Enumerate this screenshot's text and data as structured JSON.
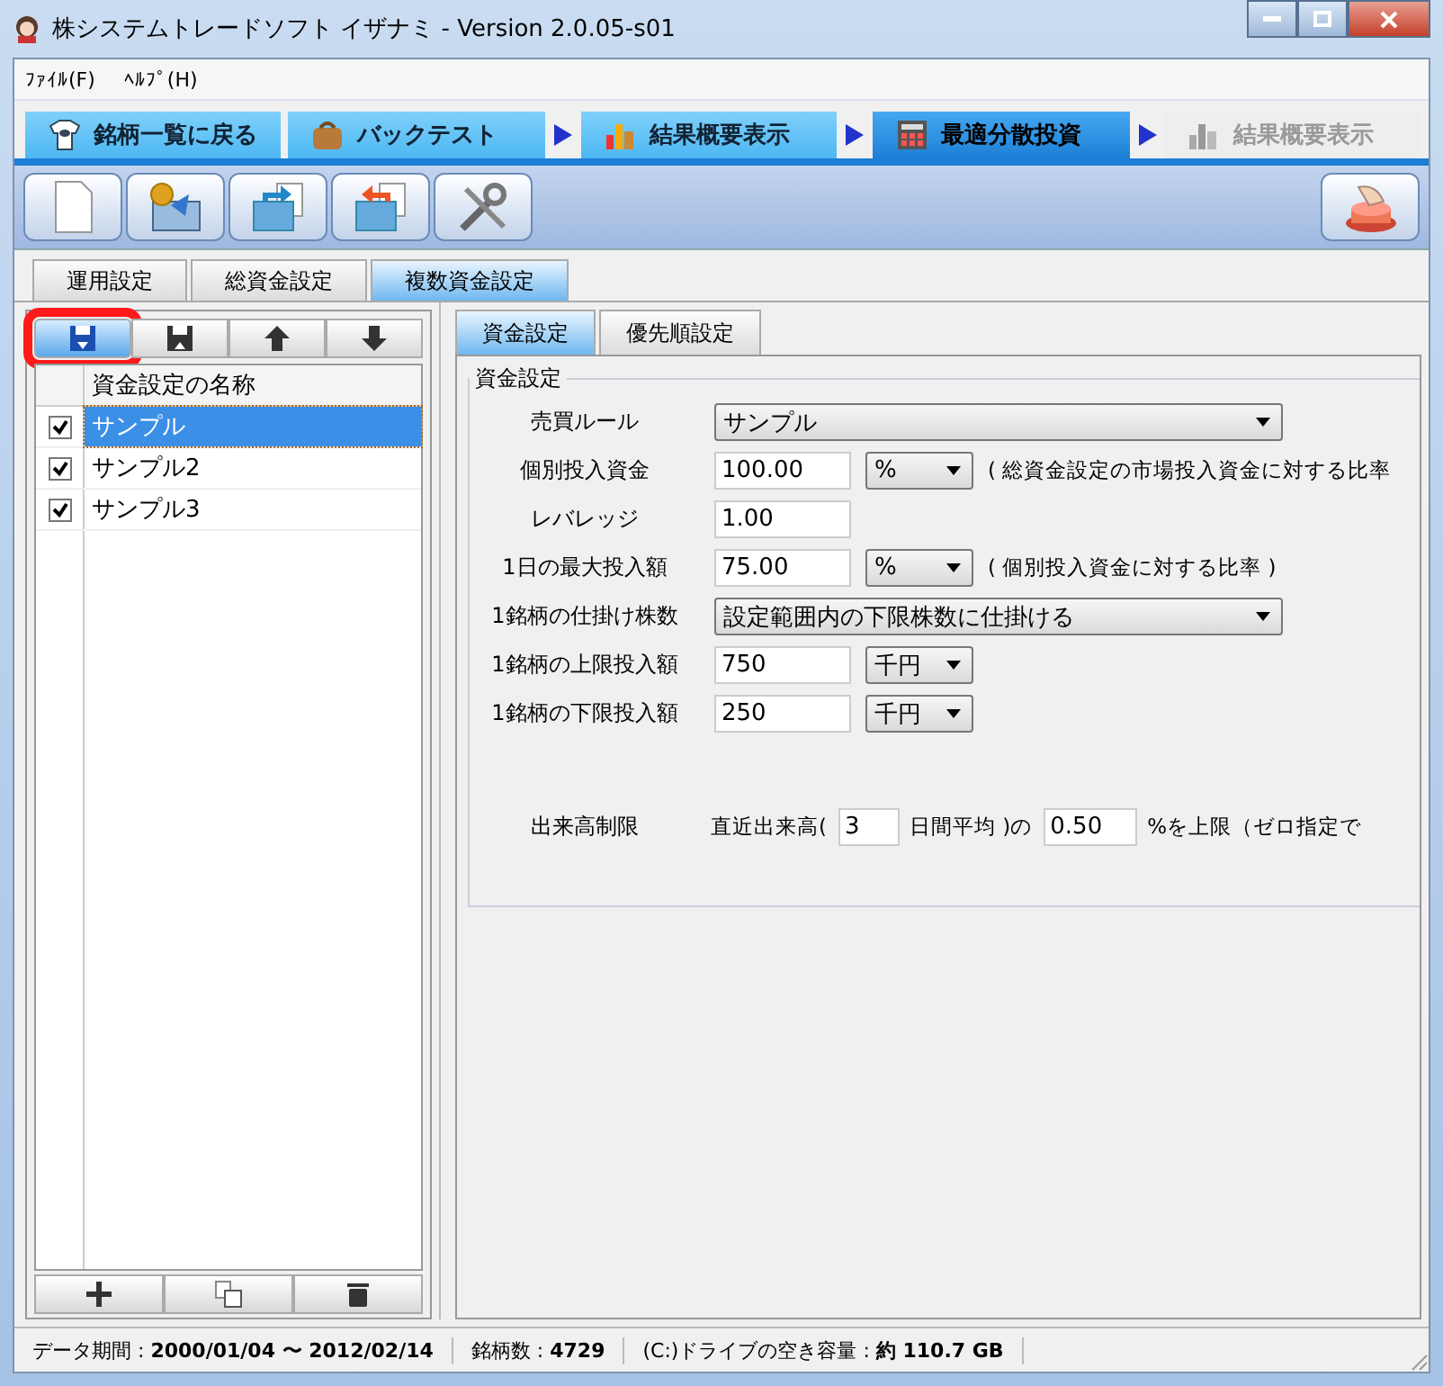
{
  "window": {
    "title": "株システムトレードソフト イザナミ - Version 2.0.05-s01"
  },
  "menu": [
    {
      "label": "ﾌｧｲﾙ(F)"
    },
    {
      "label": "ﾍﾙﾌﾟ(H)"
    }
  ],
  "nav_tabs": [
    {
      "label": "銘柄一覧に戻る",
      "kind": "eye",
      "selected": false,
      "disabled": false,
      "arrow_before": false
    },
    {
      "label": "バックテスト",
      "kind": "bag",
      "selected": false,
      "disabled": false,
      "arrow_before": false
    },
    {
      "label": "結果概要表示",
      "kind": "chart",
      "selected": false,
      "disabled": false,
      "arrow_before": true
    },
    {
      "label": "最適分散投資",
      "kind": "calc",
      "selected": true,
      "disabled": false,
      "arrow_before": true
    },
    {
      "label": "結果概要表示",
      "kind": "chart",
      "selected": false,
      "disabled": true,
      "arrow_before": true
    }
  ],
  "toolbar": [
    {
      "kind": "new"
    },
    {
      "kind": "money"
    },
    {
      "kind": "export"
    },
    {
      "kind": "import"
    },
    {
      "kind": "tools"
    }
  ],
  "settings_tabs": [
    {
      "label": "運用設定",
      "selected": false
    },
    {
      "label": "総資金設定",
      "selected": false
    },
    {
      "label": "複数資金設定",
      "selected": true
    }
  ],
  "list_toolbar": [
    {
      "kind": "save",
      "highlighted": true
    },
    {
      "kind": "save-as",
      "highlighted": false
    },
    {
      "kind": "up",
      "highlighted": false
    },
    {
      "kind": "down",
      "highlighted": false
    }
  ],
  "list": {
    "column": "資金設定の名称",
    "rows": [
      {
        "name": "サンプル",
        "checked": true,
        "selected": true
      },
      {
        "name": "サンプル2",
        "checked": true,
        "selected": false
      },
      {
        "name": "サンプル3",
        "checked": true,
        "selected": false
      }
    ]
  },
  "list_footer": [
    {
      "kind": "add"
    },
    {
      "kind": "copy"
    },
    {
      "kind": "delete"
    }
  ],
  "detail_tabs": [
    {
      "label": "資金設定",
      "selected": true
    },
    {
      "label": "優先順設定",
      "selected": false
    }
  ],
  "group": {
    "title": "資金設定",
    "rows": [
      {
        "label": "売買ルール",
        "kind": "select",
        "value": "サンプル"
      },
      {
        "label": "個別投入資金",
        "kind": "unit",
        "value": "100.00",
        "unit": "%",
        "note": "( 総資金設定の市場投入資金に対する比率"
      },
      {
        "label": "レバレッジ",
        "kind": "input",
        "value": "1.00"
      },
      {
        "label": "1日の最大投入額",
        "kind": "unit",
        "value": "75.00",
        "unit": "%",
        "note": "( 個別投入資金に対する比率 )"
      },
      {
        "label": "1銘柄の仕掛け株数",
        "kind": "select",
        "value": "設定範囲内の下限株数に仕掛ける"
      },
      {
        "label": "1銘柄の上限投入額",
        "kind": "unit",
        "value": "750",
        "unit": "千円"
      },
      {
        "label": "1銘柄の下限投入額",
        "kind": "unit",
        "value": "250",
        "unit": "千円"
      }
    ],
    "volume_limit": {
      "label": "出来高制限",
      "prefix": "直近出来高(",
      "days": "3",
      "middle": "日間平均 )の",
      "ratio": "0.50",
      "suffix": "%を上限（ゼロ指定で"
    }
  },
  "status_bar": [
    "データ期間 : **2000/01/04 〜 2012/02/14**",
    "銘柄数 : **4729**",
    "(C:)ドライブの空き容量 : **約 110.7 GB**"
  ]
}
